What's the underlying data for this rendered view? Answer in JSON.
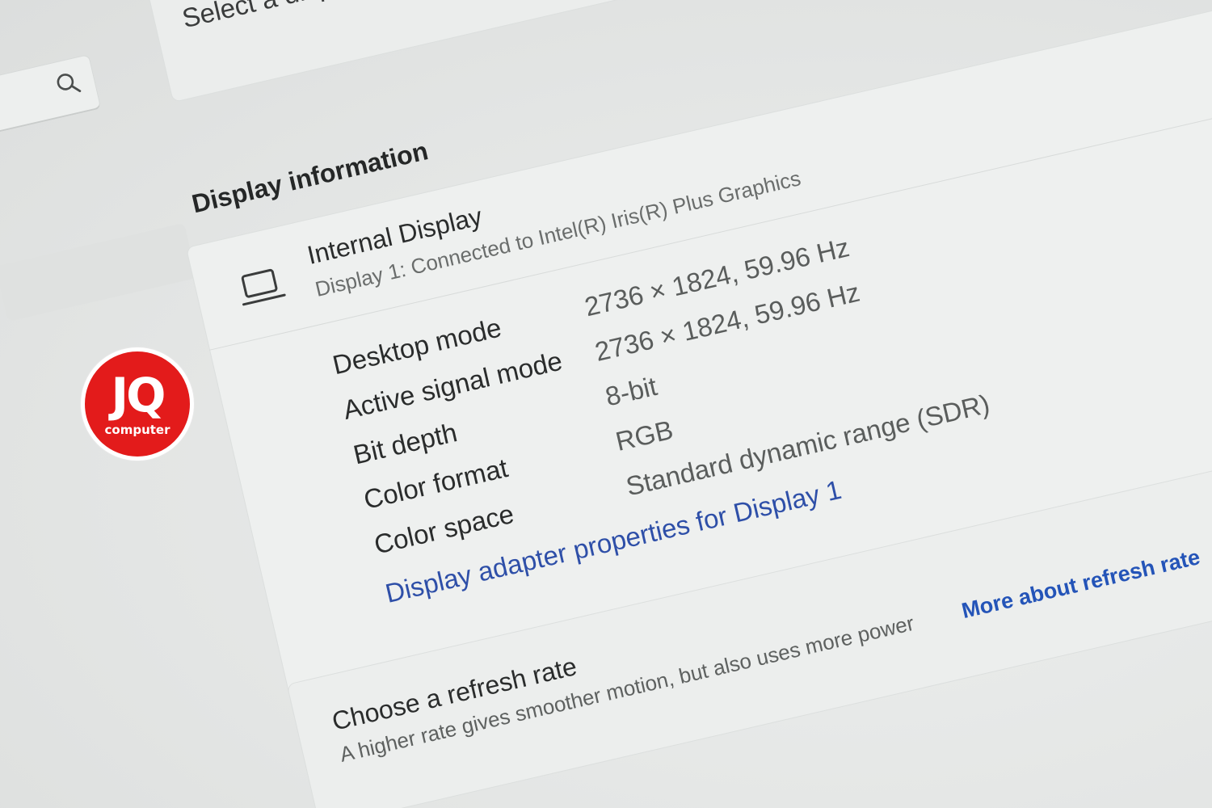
{
  "header": {
    "select_display_text": "Select a display to"
  },
  "search": {
    "icon": "search-icon"
  },
  "display_information": {
    "section_title": "Display information",
    "display_name": "Internal Display",
    "display_subtitle": "Display 1: Connected to Intel(R) Iris(R) Plus Graphics",
    "icon": "laptop-icon",
    "properties": [
      {
        "label": "Desktop mode",
        "value": "2736 × 1824, 59.96 Hz"
      },
      {
        "label": "Active signal mode",
        "value": "2736 × 1824, 59.96 Hz"
      },
      {
        "label": "Bit depth",
        "value": "8-bit"
      },
      {
        "label": "Color format",
        "value": "RGB"
      },
      {
        "label": "Color space",
        "value": "Standard dynamic range (SDR)"
      }
    ],
    "adapter_link": "Display adapter properties for Display 1"
  },
  "refresh_rate": {
    "title": "Choose a refresh rate",
    "description": "A higher rate gives smoother motion, but also uses more power",
    "link": "More about refresh rate"
  },
  "watermark": {
    "main": "JQ",
    "sub": "computer"
  },
  "colors": {
    "link": "#2e4fa8",
    "logo_red": "#e31b1b",
    "background": "#e6e8e7"
  }
}
